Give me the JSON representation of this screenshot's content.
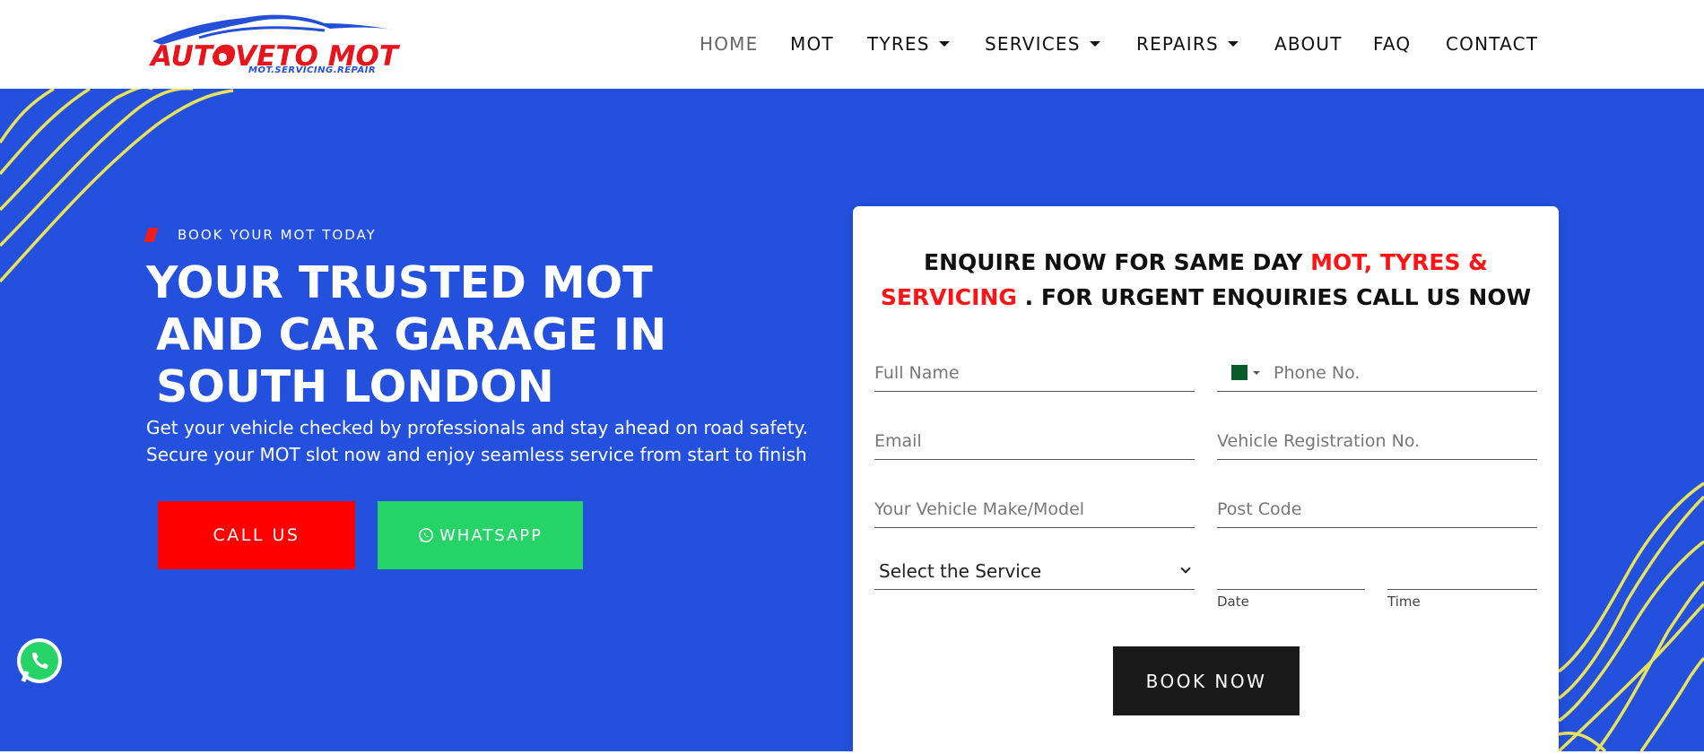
{
  "logo": {
    "brand": "AUTOVETO MOT",
    "tagline": "MOT.SERVICING.REPAIR",
    "icon": "car-silhouette-icon"
  },
  "nav": {
    "items": [
      {
        "label": "HOME",
        "dropdown": false,
        "active": true
      },
      {
        "label": "MOT",
        "dropdown": false,
        "active": false
      },
      {
        "label": "TYRES",
        "dropdown": true,
        "active": false
      },
      {
        "label": "SERVICES",
        "dropdown": true,
        "active": false
      },
      {
        "label": "REPAIRS",
        "dropdown": true,
        "active": false
      },
      {
        "label": "ABOUT",
        "dropdown": false,
        "active": false
      },
      {
        "label": "FAQ",
        "dropdown": false,
        "active": false
      },
      {
        "label": "CONTACT",
        "dropdown": false,
        "active": false
      }
    ]
  },
  "hero": {
    "eyebrow": "BOOK YOUR MOT TODAY",
    "headline": [
      "YOUR TRUSTED MOT",
      "AND CAR GARAGE IN",
      "SOUTH LONDON"
    ],
    "lede": "Get your vehicle checked by professionals and stay ahead on road safety. Secure your MOT slot now and enjoy seamless service from start to finish",
    "call_label": "CALL US",
    "whatsapp_label": "WHATSAPP",
    "whatsapp_icon": "whatsapp-icon"
  },
  "form": {
    "title_part1": "ENQUIRE NOW FOR SAME DAY",
    "title_highlight": "MOT, TYRES & SERVICING",
    "title_part2": ". FOR URGENT ENQUIRIES CALL US NOW",
    "full_name_placeholder": "Full Name",
    "phone_placeholder": "Phone No.",
    "email_placeholder": "Email",
    "vehicle_reg_placeholder": "Vehicle Registration No.",
    "make_model_placeholder": "Your Vehicle Make/Model",
    "postcode_placeholder": "Post Code",
    "service_select": "Select the Service",
    "date_label": "Date",
    "time_label": "Time",
    "submit_label": "BOOK NOW",
    "phone_flag_icon": "pakistan-flag-icon"
  },
  "colors": {
    "hero_bg": "#2351dd",
    "accent_red": "#fe0000",
    "whatsapp_green": "#25d366",
    "wave_yellow": "#e9e35a",
    "button_dark": "#1a1a1a"
  }
}
